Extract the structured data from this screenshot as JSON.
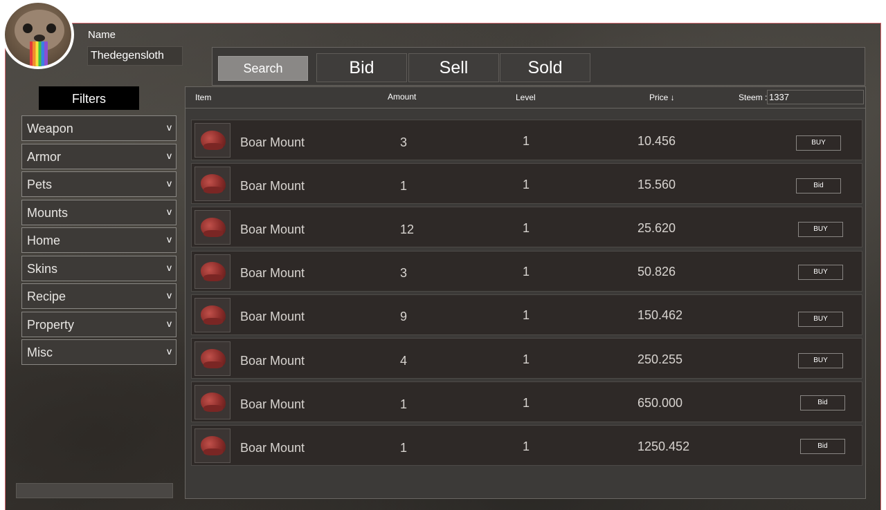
{
  "user": {
    "name_label": "Name",
    "name_value": "Thedegensloth"
  },
  "filters": {
    "title": "Filters",
    "items": [
      {
        "label": "Weapon"
      },
      {
        "label": "Armor"
      },
      {
        "label": "Pets"
      },
      {
        "label": "Mounts"
      },
      {
        "label": "Home"
      },
      {
        "label": "Skins"
      },
      {
        "label": "Recipe"
      },
      {
        "label": "Property"
      },
      {
        "label": "Misc"
      }
    ],
    "chevron": "v"
  },
  "tabs": {
    "search": "Search",
    "bid": "Bid",
    "sell": "Sell",
    "sold": "Sold"
  },
  "table": {
    "headers": {
      "item": "Item",
      "amount": "Amount",
      "level": "Level",
      "price": "Price ↓",
      "steem": "Steem :"
    },
    "steem_value": "1337",
    "rows": [
      {
        "name": "Boar Mount",
        "amount": "3",
        "level": "1",
        "price": "10.456",
        "action": "BUY"
      },
      {
        "name": "Boar Mount",
        "amount": "1",
        "level": "1",
        "price": "15.560",
        "action": "Bid"
      },
      {
        "name": "Boar Mount",
        "amount": "12",
        "level": "1",
        "price": "25.620",
        "action": "BUY"
      },
      {
        "name": "Boar Mount",
        "amount": "3",
        "level": "1",
        "price": "50.826",
        "action": "BUY"
      },
      {
        "name": "Boar Mount",
        "amount": "9",
        "level": "1",
        "price": "150.462",
        "action": "BUY"
      },
      {
        "name": "Boar Mount",
        "amount": "4",
        "level": "1",
        "price": "250.255",
        "action": "BUY"
      },
      {
        "name": "Boar Mount",
        "amount": "1",
        "level": "1",
        "price": "650.000",
        "action": "Bid"
      },
      {
        "name": "Boar Mount",
        "amount": "1",
        "level": "1",
        "price": "1250.452",
        "action": "Bid"
      }
    ]
  }
}
